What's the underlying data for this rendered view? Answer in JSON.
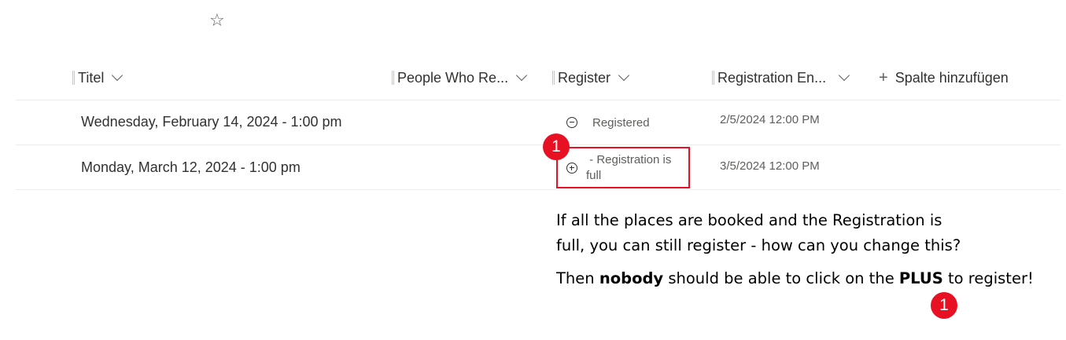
{
  "header": {
    "favorite_icon": "star-icon",
    "columns": [
      {
        "label": "Titel"
      },
      {
        "label": "People Who Re..."
      },
      {
        "label": "Register"
      },
      {
        "label": "Registration En..."
      }
    ],
    "add_column_label": "Spalte hinzufügen"
  },
  "rows": [
    {
      "title": "Wednesday, February 14, 2024 - 1:00 pm",
      "register_icon": "minus-circle-icon",
      "register_text": "Registered",
      "registration_end": "2/5/2024 12:00 PM"
    },
    {
      "title": "Monday, March 12, 2024 - 1:00 pm",
      "register_icon": "plus-circle-icon",
      "register_text_line1": " - Registration is",
      "register_text_line2": "full",
      "registration_end": "3/5/2024 12:00 PM"
    }
  ],
  "callout": {
    "badge_label": "1",
    "line1": "If all the places are booked and the Registration is",
    "line2": "full, you can still register - how can you change this?",
    "line3_pre": "Then ",
    "line3_bold1": "nobody",
    "line3_mid": " should be able to click on the ",
    "line3_bold2": "PLUS",
    "line3_post": " to register!",
    "accent_color": "#e81123"
  }
}
